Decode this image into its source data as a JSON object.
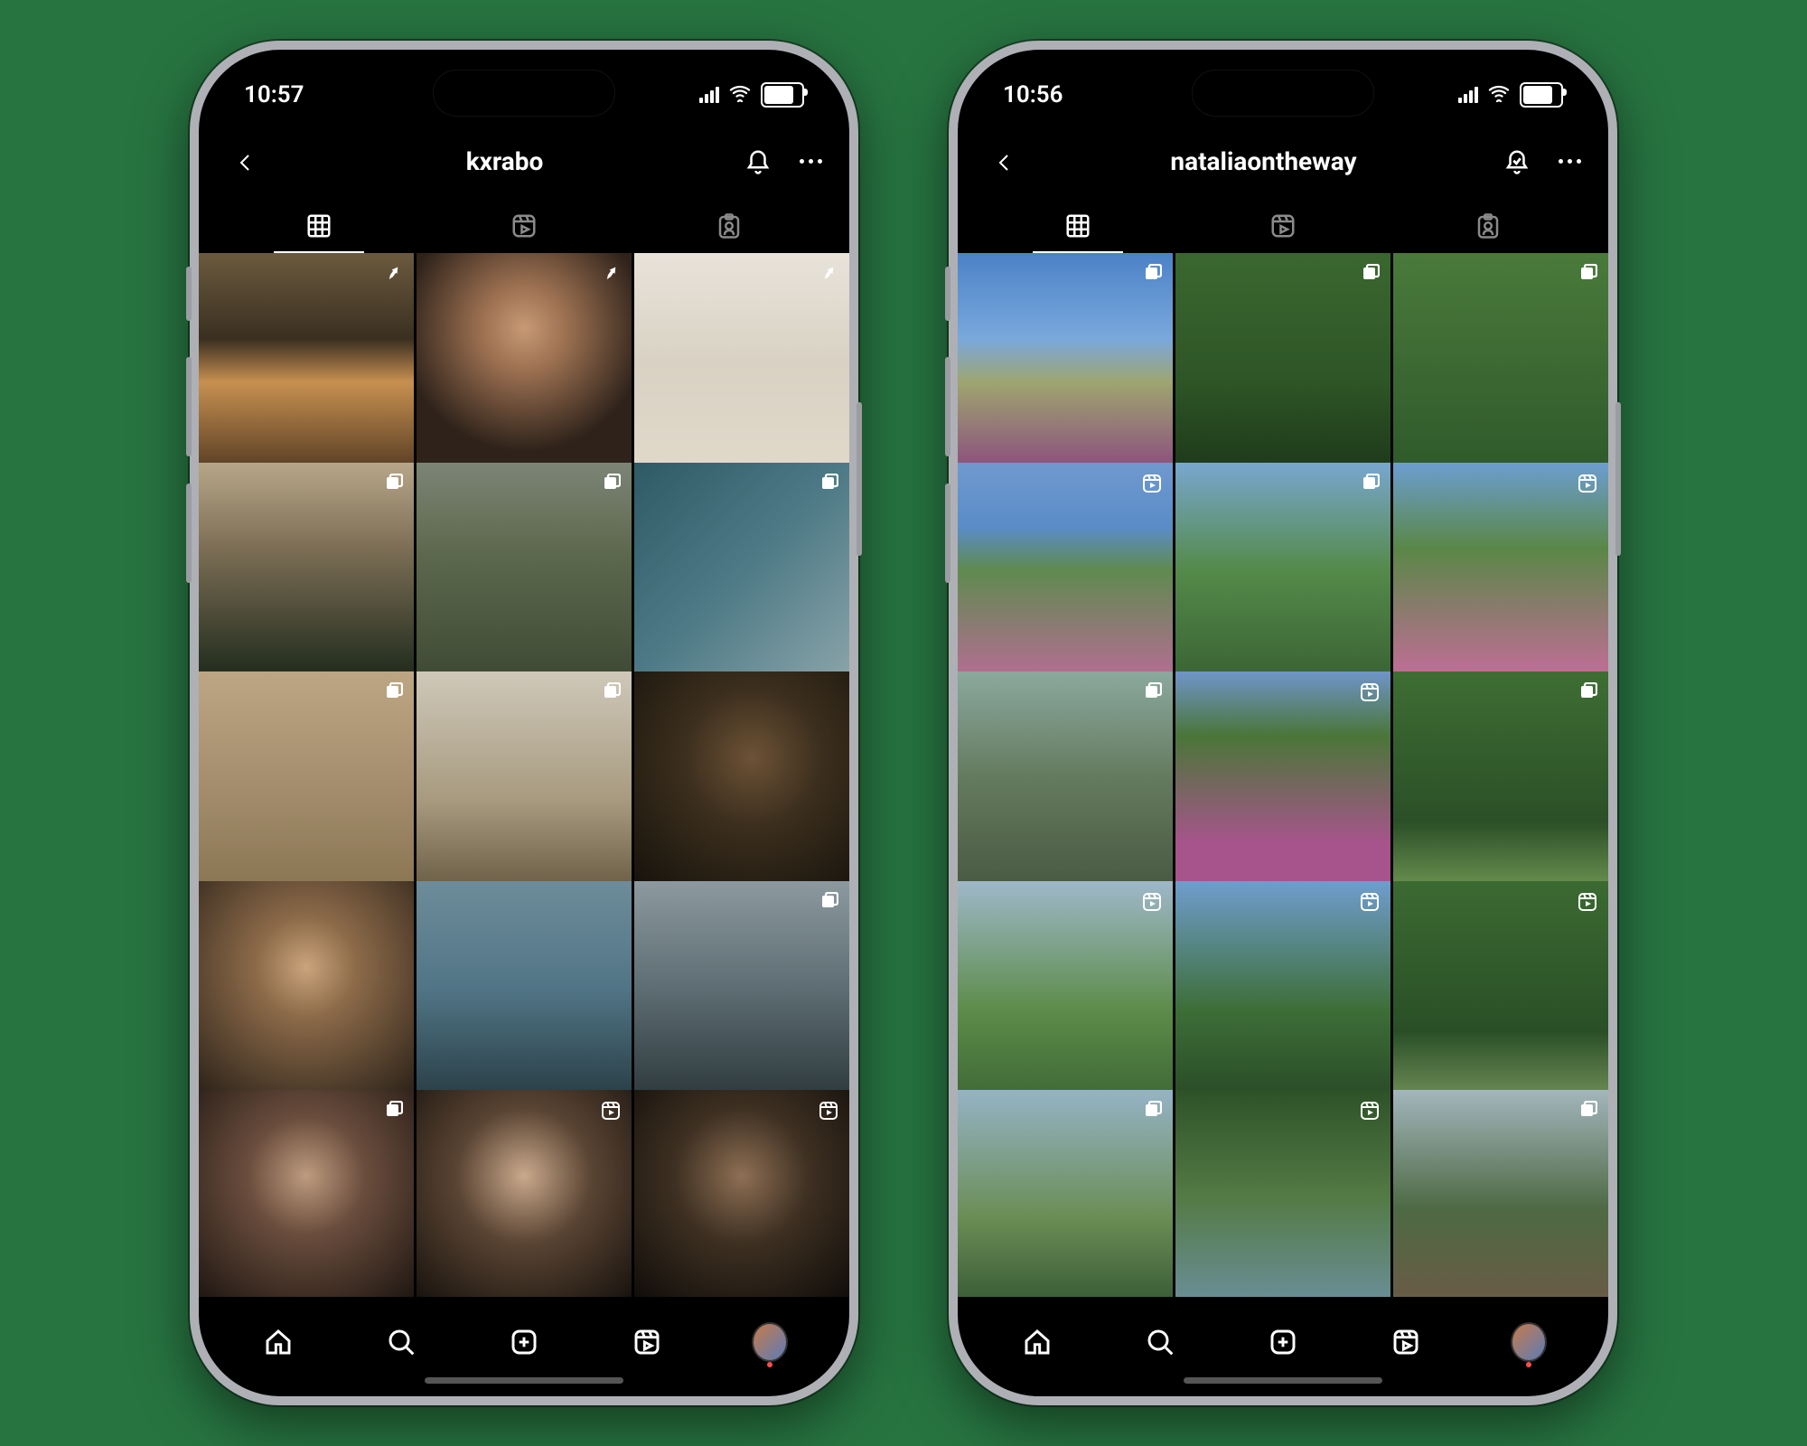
{
  "phones": [
    {
      "status_time": "10:57",
      "profile_username": "kxrabo",
      "notification_state": "default",
      "tabs": {
        "active_index": 0
      },
      "posts": [
        {
          "row": 0,
          "col": 0,
          "overlay": "pinned",
          "style": "g-warm1"
        },
        {
          "row": 0,
          "col": 1,
          "overlay": "pinned",
          "style": "g-portrait1"
        },
        {
          "row": 0,
          "col": 2,
          "overlay": "pinned",
          "style": "g-portrait2"
        },
        {
          "row": 1,
          "col": 0,
          "overlay": "carousel",
          "style": "g-dusk"
        },
        {
          "row": 1,
          "col": 1,
          "overlay": "carousel",
          "style": "g-field"
        },
        {
          "row": 1,
          "col": 2,
          "overlay": "carousel",
          "style": "g-building"
        },
        {
          "row": 2,
          "col": 0,
          "overlay": "carousel",
          "style": "g-board"
        },
        {
          "row": 2,
          "col": 1,
          "overlay": "carousel",
          "style": "g-interior"
        },
        {
          "row": 2,
          "col": 2,
          "overlay": "none",
          "style": "g-portrait3"
        },
        {
          "row": 3,
          "col": 0,
          "overlay": "none",
          "style": "g-face1"
        },
        {
          "row": 3,
          "col": 1,
          "overlay": "none",
          "style": "g-boat"
        },
        {
          "row": 3,
          "col": 2,
          "overlay": "carousel",
          "style": "g-marina"
        },
        {
          "row": 4,
          "col": 0,
          "overlay": "carousel",
          "style": "g-smile1"
        },
        {
          "row": 4,
          "col": 1,
          "overlay": "reel",
          "style": "g-smile2"
        },
        {
          "row": 4,
          "col": 2,
          "overlay": "reel",
          "style": "g-smile3"
        }
      ]
    },
    {
      "status_time": "10:56",
      "profile_username": "nataliaontheway",
      "notification_state": "checked",
      "tabs": {
        "active_index": 0
      },
      "posts": [
        {
          "row": 0,
          "col": 0,
          "overlay": "carousel",
          "style": "g-sky1"
        },
        {
          "row": 0,
          "col": 1,
          "overlay": "carousel",
          "style": "g-tree1"
        },
        {
          "row": 0,
          "col": 2,
          "overlay": "carousel",
          "style": "g-forest1"
        },
        {
          "row": 1,
          "col": 0,
          "overlay": "reel",
          "style": "g-pink"
        },
        {
          "row": 1,
          "col": 1,
          "overlay": "carousel",
          "style": "g-willow"
        },
        {
          "row": 1,
          "col": 2,
          "overlay": "reel",
          "style": "g-tulip"
        },
        {
          "row": 2,
          "col": 0,
          "overlay": "carousel",
          "style": "g-meadow"
        },
        {
          "row": 2,
          "col": 1,
          "overlay": "reel",
          "style": "g-lupine"
        },
        {
          "row": 2,
          "col": 2,
          "overlay": "carousel",
          "style": "g-path"
        },
        {
          "row": 3,
          "col": 0,
          "overlay": "reel",
          "style": "g-hills"
        },
        {
          "row": 3,
          "col": 1,
          "overlay": "reel",
          "style": "g-lakebig"
        },
        {
          "row": 3,
          "col": 2,
          "overlay": "reel",
          "style": "g-woods"
        },
        {
          "row": 4,
          "col": 0,
          "overlay": "carousel",
          "style": "g-mount"
        },
        {
          "row": 4,
          "col": 1,
          "overlay": "reel",
          "style": "g-reflect"
        },
        {
          "row": 4,
          "col": 2,
          "overlay": "carousel",
          "style": "g-cottage"
        }
      ]
    }
  ],
  "tab_icons": [
    "grid",
    "reels",
    "tagged"
  ],
  "bottom_nav": [
    "home",
    "search",
    "create",
    "reels",
    "profile"
  ]
}
